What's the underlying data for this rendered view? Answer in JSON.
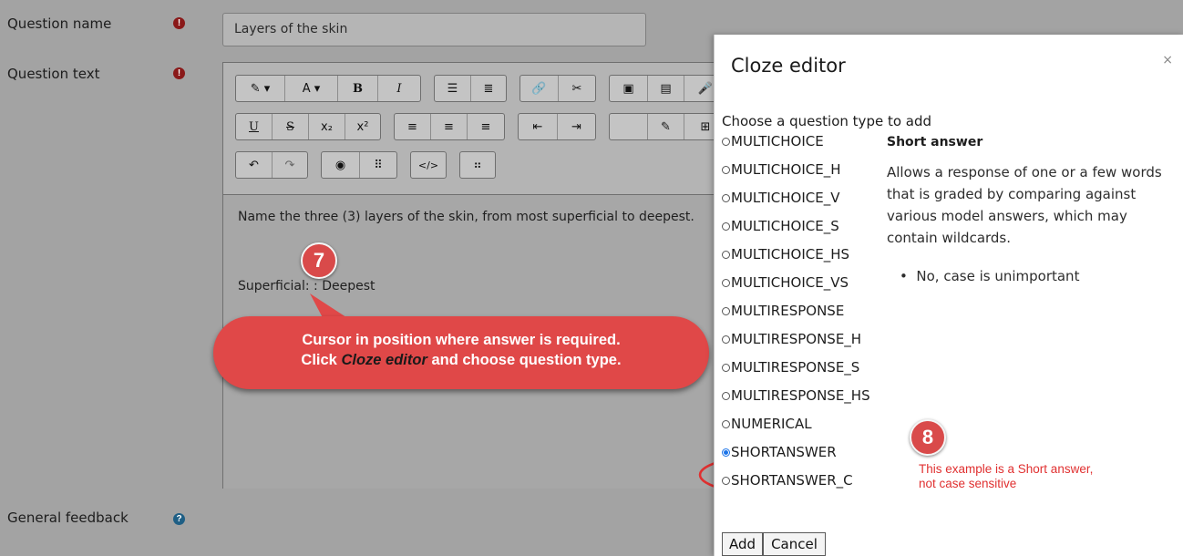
{
  "form": {
    "question_name_label": "Question name",
    "question_name_value": "Layers of the skin",
    "question_text_label": "Question text",
    "general_feedback_label": "General feedback",
    "required_icon": "!",
    "help_icon": "?"
  },
  "toolbar": {
    "row1": {
      "g1": [
        "✓",
        "A ▾"
      ],
      "g1_labels": [
        "brush-dropdown",
        "font-dropdown"
      ],
      "bold": "B",
      "italic": "I"
    },
    "row2": {
      "underline": "U",
      "strike": "S",
      "sub": "x₂",
      "sup": "x²"
    }
  },
  "editor": {
    "line1": "Name the three (3) layers of the skin, from most superficial to deepest.",
    "line2": "Superficial: : Deepest"
  },
  "annotations": {
    "badge7": "7",
    "callout_line1": "Cursor in position where answer is required.",
    "callout_line2_pre": "Click ",
    "callout_line2_em": "Cloze editor",
    "callout_line2_post": " and choose question type.",
    "badge8": "8",
    "note_line1": "This example is a Short answer,",
    "note_line2": "not case sensitive"
  },
  "modal": {
    "title": "Cloze editor",
    "close": "×",
    "prompt": "Choose a question type to add",
    "options": [
      "MULTICHOICE",
      "MULTICHOICE_H",
      "MULTICHOICE_V",
      "MULTICHOICE_S",
      "MULTICHOICE_HS",
      "MULTICHOICE_VS",
      "MULTIRESPONSE",
      "MULTIRESPONSE_H",
      "MULTIRESPONSE_S",
      "MULTIRESPONSE_HS",
      "NUMERICAL",
      "SHORTANSWER",
      "SHORTANSWER_C"
    ],
    "selected": "SHORTANSWER",
    "desc_title": "Short answer",
    "desc": "Allows a response of one or a few words that is graded by comparing against various model answers, which may contain wildcards.",
    "bullet": "No, case is unimportant",
    "add_label": "Add",
    "cancel_label": "Cancel"
  },
  "colors": {
    "accent_red": "#e04848",
    "radio_blue": "#1a73e8"
  }
}
